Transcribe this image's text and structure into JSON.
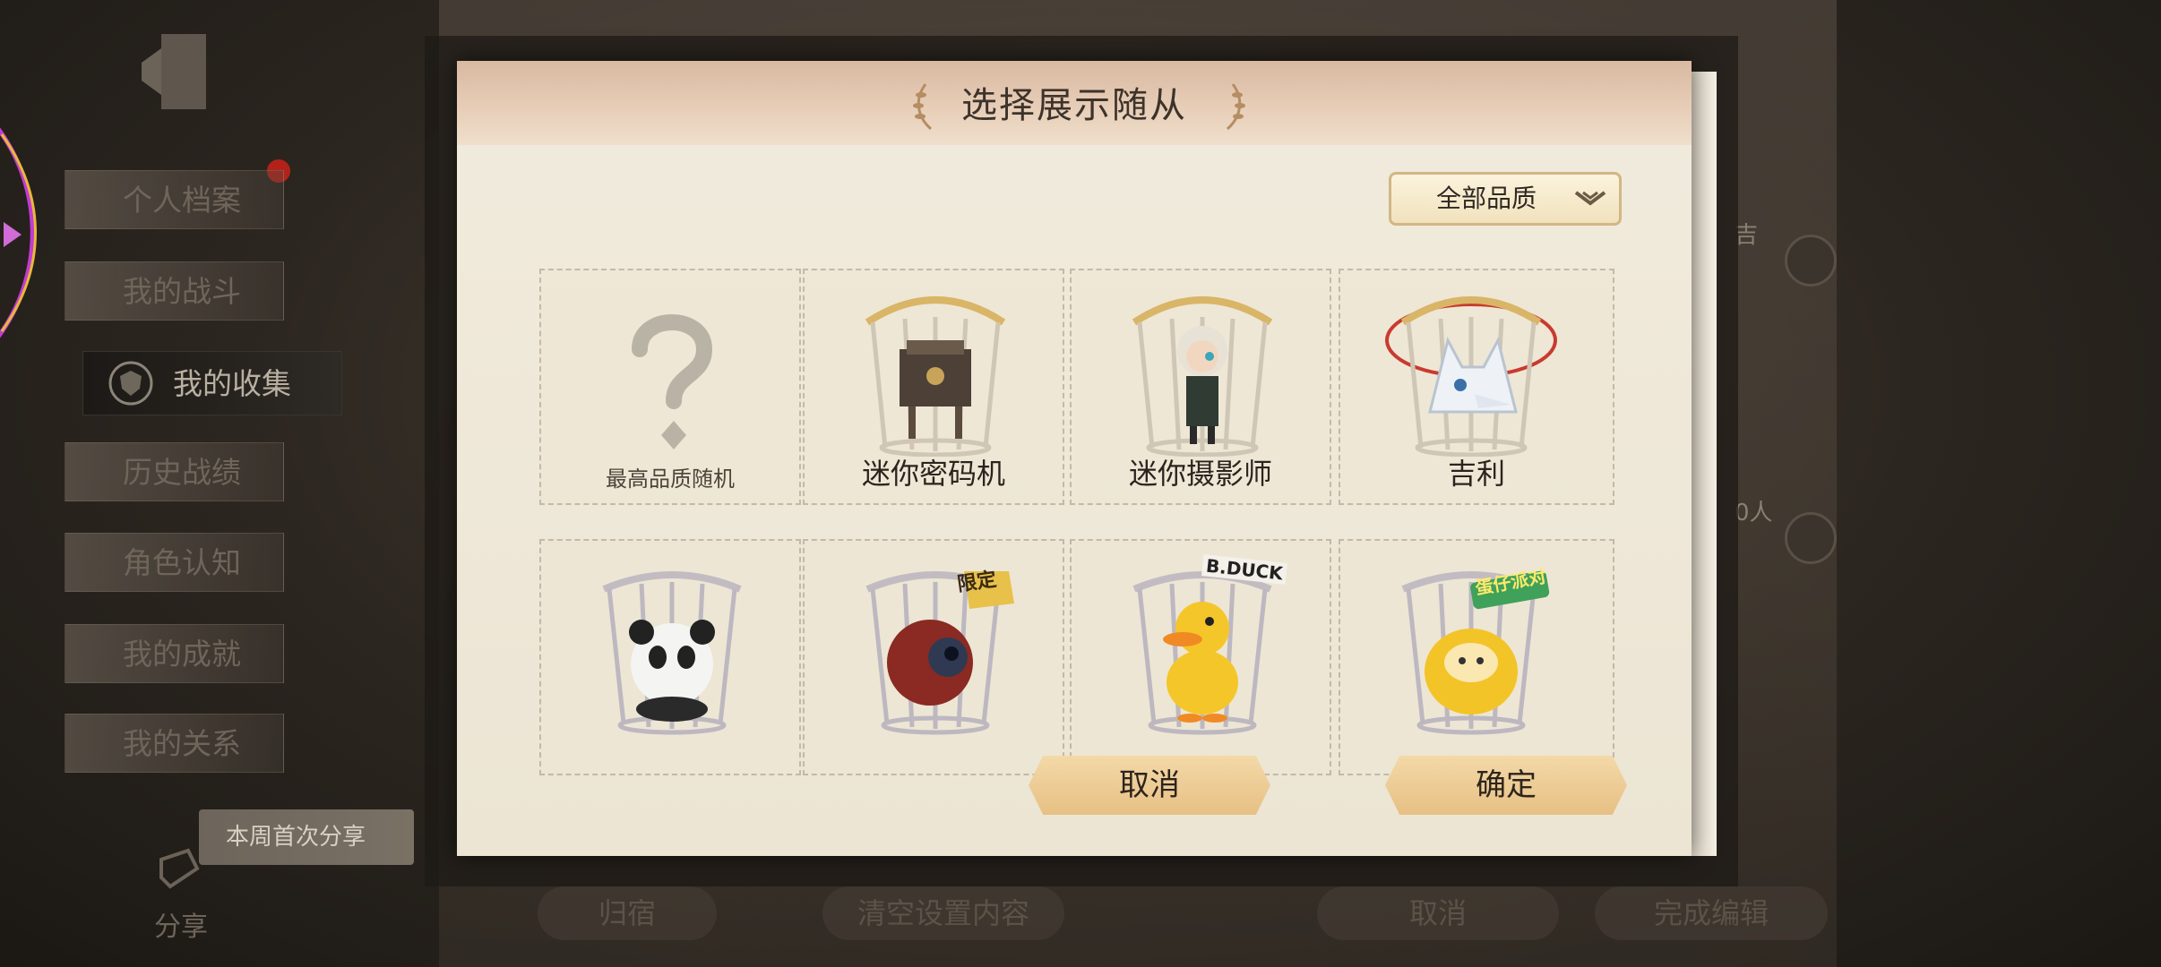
{
  "sidebar": {
    "items": [
      {
        "label": "个人档案"
      },
      {
        "label": "我的战斗"
      },
      {
        "label": "我的收集"
      },
      {
        "label": "历史战绩"
      },
      {
        "label": "角色认知"
      },
      {
        "label": "我的成就"
      },
      {
        "label": "我的关系"
      }
    ],
    "active_index": 2
  },
  "share": {
    "weekly_label": "本周首次分享",
    "label": "分享"
  },
  "bottom_bar": {
    "return_label": "归宿",
    "clear_label": "清空设置内容",
    "cancel_label": "取消",
    "finish_label": "完成编辑"
  },
  "right_panel": {
    "text_1": "吉",
    "text_2": "0人"
  },
  "modal": {
    "title": "选择展示随从",
    "quality_dropdown": {
      "selected": "全部品质"
    },
    "pets": [
      {
        "name": "最高品质随机",
        "icon": "question-mark-icon"
      },
      {
        "name": "迷你密码机",
        "icon": "mini-cipher-machine-icon"
      },
      {
        "name": "迷你摄影师",
        "icon": "mini-photographer-icon"
      },
      {
        "name": "吉利",
        "icon": "white-wolf-pet-icon"
      },
      {
        "name": "",
        "icon": "panda-pet-icon"
      },
      {
        "name": "",
        "icon": "eyeball-pet-icon",
        "badge": "限定"
      },
      {
        "name": "",
        "icon": "yellow-duck-pet-icon",
        "badge": "B.DUCK"
      },
      {
        "name": "",
        "icon": "eggy-pet-icon",
        "badge": "蛋仔派对"
      }
    ],
    "cancel_label": "取消",
    "confirm_label": "确定"
  },
  "colors": {
    "modal_paper": "#ece5d4",
    "header_peach": "#e2c6ae",
    "button_gold": "#ecc88e",
    "badge_gold": "#e8c14a",
    "badge_green": "#3fa15a"
  }
}
